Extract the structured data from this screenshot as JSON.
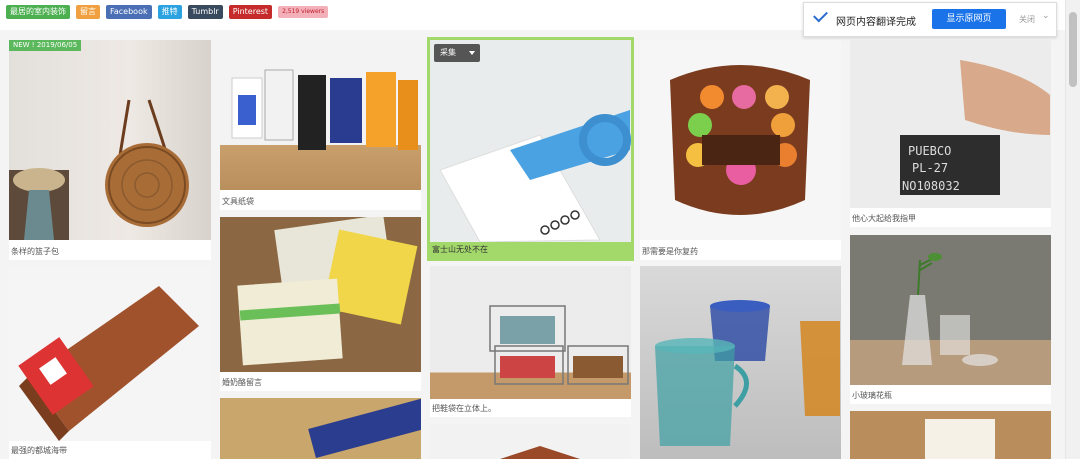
{
  "tags": [
    {
      "label": "最居的室内装饰",
      "color": "#4caf50",
      "name": "tag-interior"
    },
    {
      "label": "留言",
      "color": "#f0a040",
      "name": "tag-comment"
    },
    {
      "label": "Facebook",
      "color": "#4a6fb5",
      "name": "tag-facebook"
    },
    {
      "label": "推特",
      "color": "#2aa3e0",
      "name": "tag-twitter"
    },
    {
      "label": "Tumblr",
      "color": "#3a4a5e",
      "name": "tag-tumblr"
    },
    {
      "label": "Pinterest",
      "color": "#c62b2b",
      "name": "tag-pinterest"
    },
    {
      "label": "2,519 viewers",
      "color": "#f3b0b8",
      "name": "tag-viewers"
    }
  ],
  "translate_bar": {
    "message": "网页内容翻译完成",
    "show_original": "显示原网页",
    "close": "关闭"
  },
  "cards": [
    {
      "caption": "条样的篮子包",
      "badge": "NEW ! 2019/06/05"
    },
    {
      "caption": "最强的都城海带"
    },
    {
      "caption": "文具纸袋"
    },
    {
      "caption": "婚奶酪留言"
    },
    {
      "caption": ""
    },
    {
      "caption": "富士山无处不在",
      "collect": "采集"
    },
    {
      "caption": "把鞋袋在立体上。"
    },
    {
      "caption": ""
    },
    {
      "caption": "那需要是你复药"
    },
    {
      "caption": ""
    },
    {
      "caption": "他心大起给我指甲"
    },
    {
      "caption": "小玻璃花瓶"
    },
    {
      "caption": ""
    }
  ]
}
